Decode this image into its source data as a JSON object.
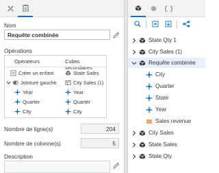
{
  "left_panel": {
    "name_label": "Nom",
    "name_value": "Requête combinée",
    "operations_label": "Opérations",
    "operations": {
      "col_operators": "Opérateurs",
      "col_cubes": "Cubes secondaires",
      "rows": [
        {
          "op": "Créer un enfant",
          "cube": "State Sales"
        },
        {
          "op": "Jointure gauche",
          "cube": "City Sales (1)"
        },
        {
          "op": "Year",
          "cube": "Year"
        },
        {
          "op": "Quarter",
          "cube": "Quarter"
        },
        {
          "op": "City",
          "cube": "City"
        }
      ]
    },
    "rows_label": "Nombre de ligne(s)",
    "rows_value": "204",
    "cols_label": "Nombre de colonne(s)",
    "cols_value": "5",
    "description_label": "Description"
  },
  "right_panel": {
    "tree": [
      {
        "label": "State Qty 1",
        "expanded": false
      },
      {
        "label": "City Sales (1)",
        "expanded": false
      },
      {
        "label": "Requête combinée",
        "expanded": true,
        "selected": true
      },
      {
        "label": "City",
        "child": true,
        "icon": "dimension-icon"
      },
      {
        "label": "Quarter",
        "child": true,
        "icon": "dimension-icon"
      },
      {
        "label": "State",
        "child": true,
        "icon": "dimension-icon"
      },
      {
        "label": "Year",
        "child": true,
        "icon": "dimension-icon"
      },
      {
        "label": "Sales revenue",
        "child": true,
        "icon": "measure-icon"
      },
      {
        "label": "City Sales",
        "expanded": false
      },
      {
        "label": "State Sales",
        "expanded": false
      },
      {
        "label": "State Qty",
        "expanded": false
      }
    ]
  },
  "colors": {
    "accent": "#0a6ed1",
    "measure": "#e9730c",
    "selected_bg": "#e5f0fa"
  }
}
